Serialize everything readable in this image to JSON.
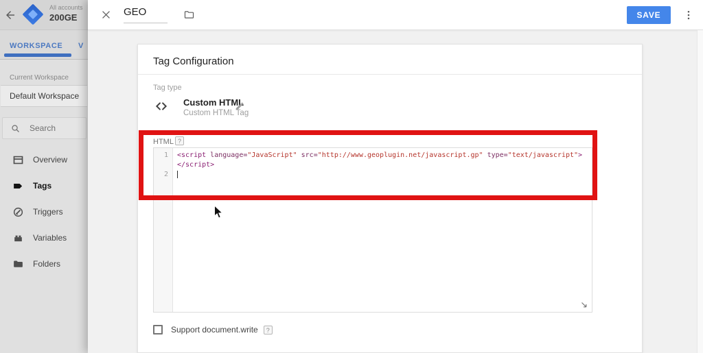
{
  "colors": {
    "accent_blue": "#4486ea",
    "annotation_red": "#e01313",
    "tab_blue": "#4c79c1",
    "code_tag": "#8b2073",
    "code_string": "#b5352c"
  },
  "app_header": {
    "account_label": "All accounts",
    "container_name": "200GE"
  },
  "tabs": {
    "workspace": "WORKSPACE",
    "versions_truncated": "V"
  },
  "sidebar": {
    "current_workspace_label": "Current Workspace",
    "workspace_name": "Default Workspace",
    "search_placeholder": "Search",
    "items": [
      {
        "label": "Overview",
        "active": false
      },
      {
        "label": "Tags",
        "active": true
      },
      {
        "label": "Triggers",
        "active": false
      },
      {
        "label": "Variables",
        "active": false
      },
      {
        "label": "Folders",
        "active": false
      }
    ]
  },
  "editor_topbar": {
    "title": "GEO",
    "save_label": "SAVE"
  },
  "panel": {
    "title": "Tag Configuration",
    "tag_type_label": "Tag type",
    "tag_type_name": "Custom HTML",
    "tag_type_desc": "Custom HTML Tag",
    "html_label": "HTML",
    "help": "?"
  },
  "code_editor": {
    "line_numbers": {
      "row1": "1",
      "row2": "",
      "row3": "2"
    },
    "rows": {
      "row1": {
        "s1": "<script ",
        "s2": "language=",
        "s3": "\"JavaScript\" ",
        "s4": "src=",
        "s5": "\"http://www.geoplugin.net/javascript.gp\" ",
        "s6": "type=",
        "s7": "\"text/javascript\"",
        "s8": ">"
      },
      "row2": {
        "s1": "</script>"
      }
    }
  },
  "support_row": {
    "label": "Support document.write",
    "help": "?"
  }
}
